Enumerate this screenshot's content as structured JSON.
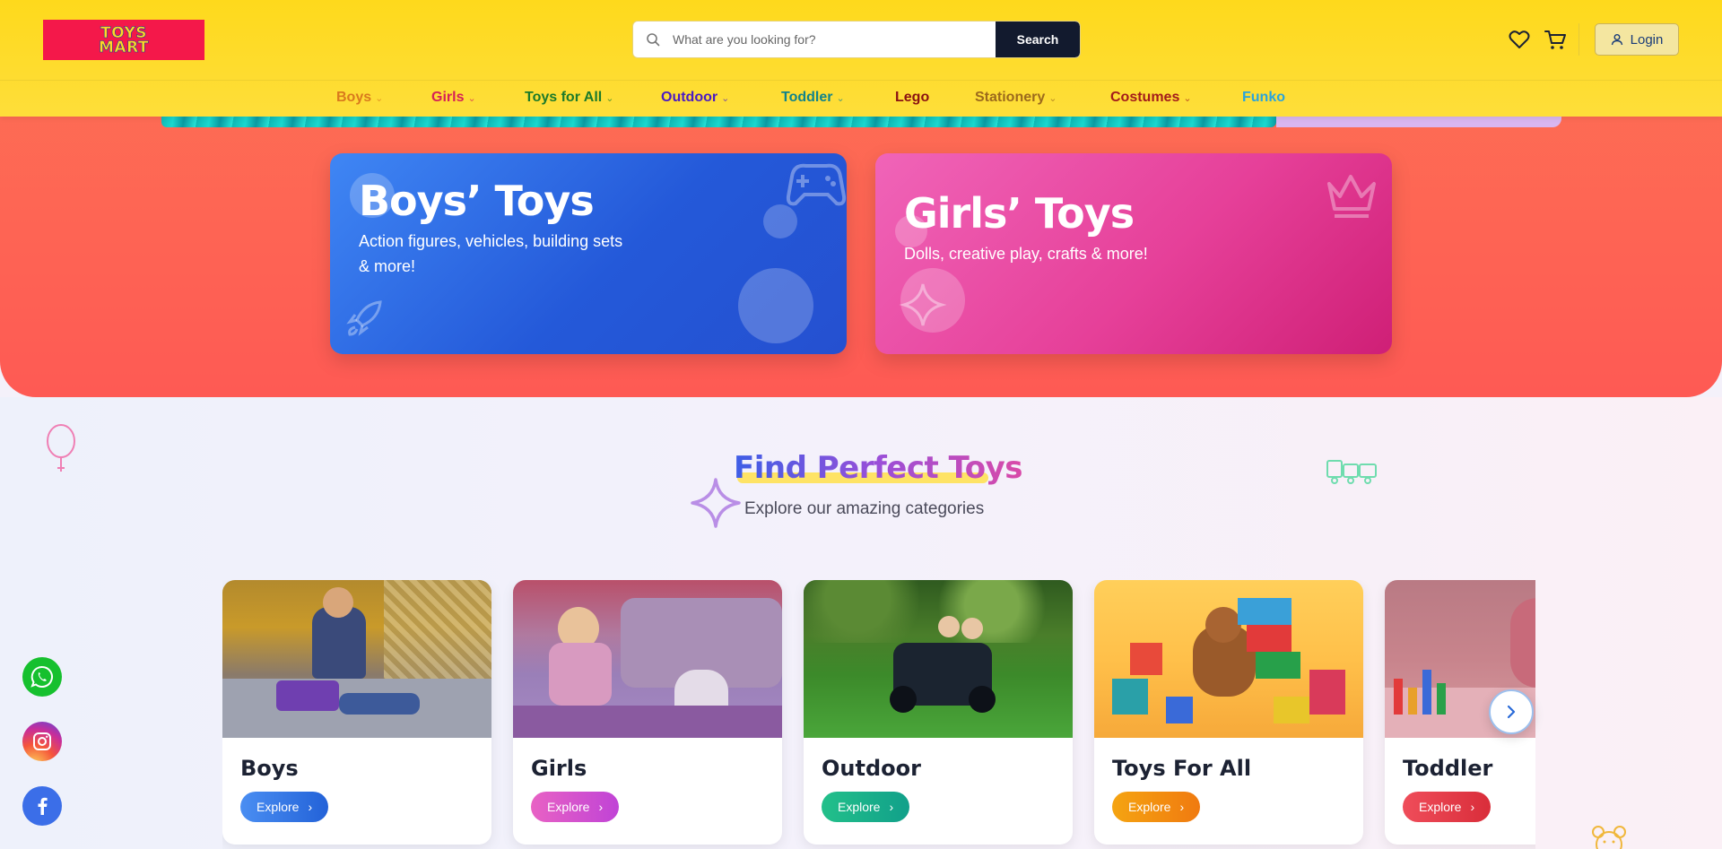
{
  "header": {
    "logo": {
      "line1": "TOYS",
      "line2": "MART"
    },
    "search": {
      "placeholder": "What are you looking for?",
      "button_label": "Search"
    },
    "login_label": "Login"
  },
  "nav": [
    {
      "label": "Boys",
      "has_dropdown": true,
      "color": "#d97a1d"
    },
    {
      "label": "Girls",
      "has_dropdown": true,
      "color": "#d62056"
    },
    {
      "label": "Toys for All",
      "has_dropdown": true,
      "color": "#1c7a2a"
    },
    {
      "label": "Outdoor",
      "has_dropdown": true,
      "color": "#4a1ac4"
    },
    {
      "label": "Toddler",
      "has_dropdown": true,
      "color": "#11838a"
    },
    {
      "label": "Lego",
      "has_dropdown": false,
      "color": "#8a1212"
    },
    {
      "label": "Stationery",
      "has_dropdown": true,
      "color": "#9c6a1c"
    },
    {
      "label": "Costumes",
      "has_dropdown": true,
      "color": "#a31b1b"
    },
    {
      "label": "Funko",
      "has_dropdown": false,
      "color": "#2aa4dc"
    }
  ],
  "promos": {
    "boys": {
      "title": "Boys’ Toys",
      "subtitle_line1": "Action figures, vehicles, building sets",
      "subtitle_line2": "& more!"
    },
    "girls": {
      "title": "Girls’ Toys",
      "subtitle": "Dolls, creative play, crafts & more!"
    }
  },
  "section": {
    "title": "Find Perfect Toys",
    "subtitle": "Explore our amazing categories"
  },
  "categories": [
    {
      "name": "Boys",
      "button": "Explore",
      "color_from": "#4a8ef2",
      "color_to": "#2362d8"
    },
    {
      "name": "Girls",
      "button": "Explore",
      "color_from": "#e862c4",
      "color_to": "#c043d6"
    },
    {
      "name": "Outdoor",
      "button": "Explore",
      "color_from": "#23c08a",
      "color_to": "#11a08a"
    },
    {
      "name": "Toys For All",
      "button": "Explore",
      "color_from": "#f5a411",
      "color_to": "#f07a10"
    },
    {
      "name": "Toddler",
      "button": "Explore",
      "color_from": "#ef4d5a",
      "color_to": "#d92d3a"
    }
  ],
  "social": [
    "whatsapp-icon",
    "instagram-icon",
    "facebook-icon"
  ]
}
